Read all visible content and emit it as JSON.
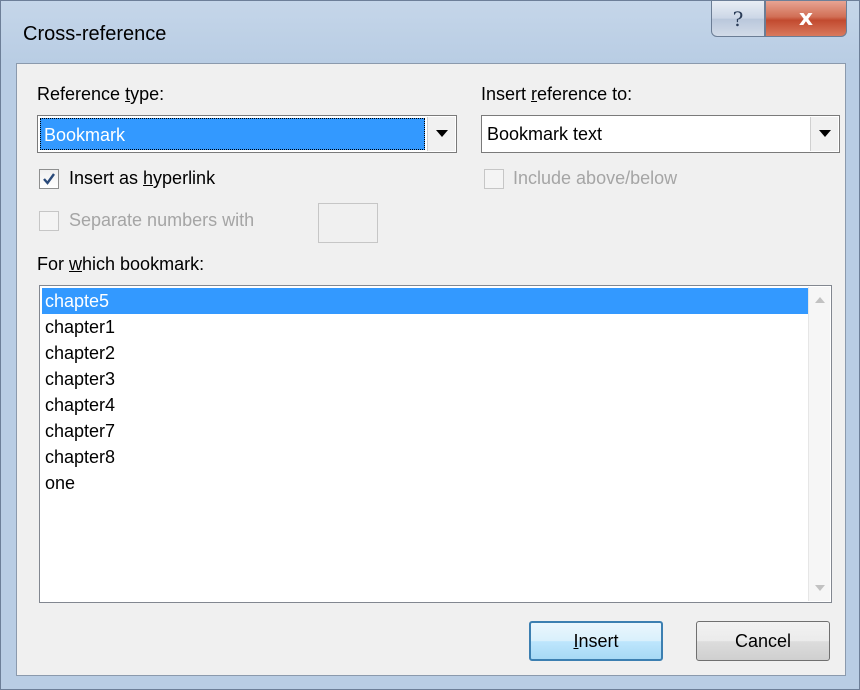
{
  "window": {
    "title": "Cross-reference",
    "help_glyph": "?",
    "close_glyph": "x"
  },
  "reference_type": {
    "label_pre": "Reference ",
    "label_access": "t",
    "label_post": "ype:",
    "value": "Bookmark"
  },
  "insert_reference_to": {
    "label_pre": "Insert ",
    "label_access": "r",
    "label_post": "eference to:",
    "value": "Bookmark text"
  },
  "insert_as_hyperlink": {
    "label_pre": "Insert as ",
    "label_access": "h",
    "label_post": "yperlink",
    "checked": true
  },
  "include_above_below": {
    "label": "Include above/below",
    "checked": false,
    "disabled": true
  },
  "separate_numbers": {
    "label": "Separate numbers with",
    "checked": false,
    "disabled": true,
    "value": ""
  },
  "for_which": {
    "label_pre": "For ",
    "label_access": "w",
    "label_post": "hich bookmark:",
    "items": [
      "chapte5",
      "chapter1",
      "chapter2",
      "chapter3",
      "chapter4",
      "chapter7",
      "chapter8",
      "one"
    ],
    "selected_index": 0
  },
  "buttons": {
    "insert_access": "I",
    "insert_rest": "nsert",
    "cancel": "Cancel"
  },
  "icons": {
    "help": "help-icon",
    "close": "close-icon",
    "dropdown": "chevron-down-icon",
    "check": "checkmark-icon",
    "scroll_up": "scroll-up-arrow-icon",
    "scroll_down": "scroll-down-arrow-icon"
  },
  "colors": {
    "selection": "#3399ff",
    "frame": "#b9cde4",
    "close_button": "#c24a2f",
    "default_button_border": "#3c7fb1"
  }
}
